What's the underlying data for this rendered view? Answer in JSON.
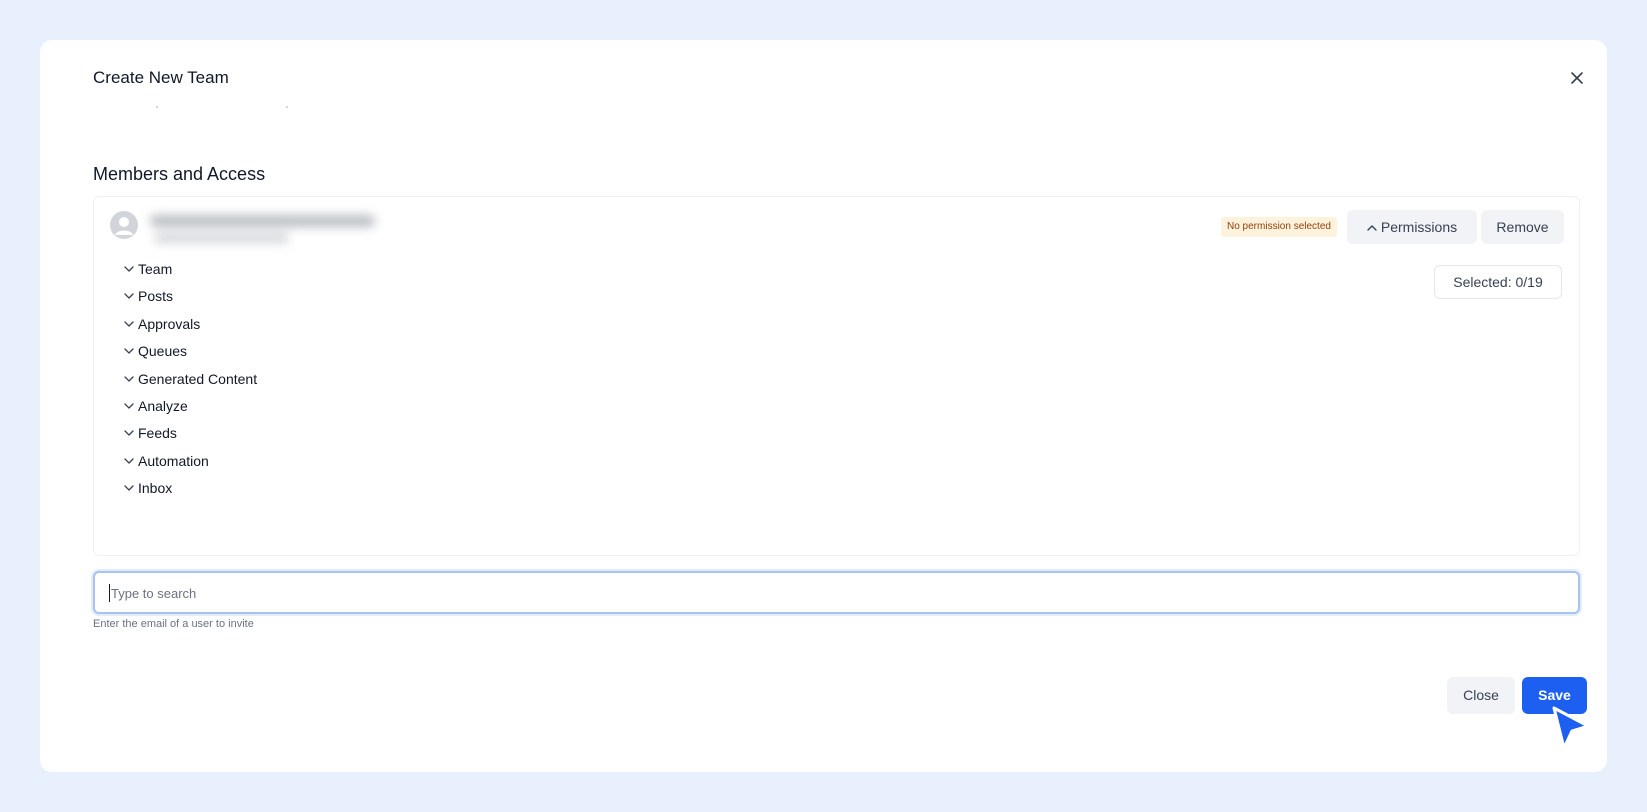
{
  "modal": {
    "title": "Create New Team"
  },
  "members": {
    "section_title": "Members and Access",
    "member": {
      "permission_badge": "No permission selected",
      "permissions_button": "Permissions",
      "remove_button": "Remove",
      "selected_count": "Selected: 0/19",
      "permission_groups": [
        "Team",
        "Posts",
        "Approvals",
        "Queues",
        "Generated Content",
        "Analyze",
        "Feeds",
        "Automation",
        "Inbox"
      ]
    }
  },
  "search": {
    "placeholder": "Type to search",
    "value": "",
    "hint": "Enter the email of a user to invite"
  },
  "footer": {
    "close_label": "Close",
    "save_label": "Save"
  },
  "colors": {
    "page_background": "#e9f0fd",
    "primary": "#1d5ff0",
    "badge_background": "#fdf2dc",
    "badge_text": "#92400e"
  }
}
